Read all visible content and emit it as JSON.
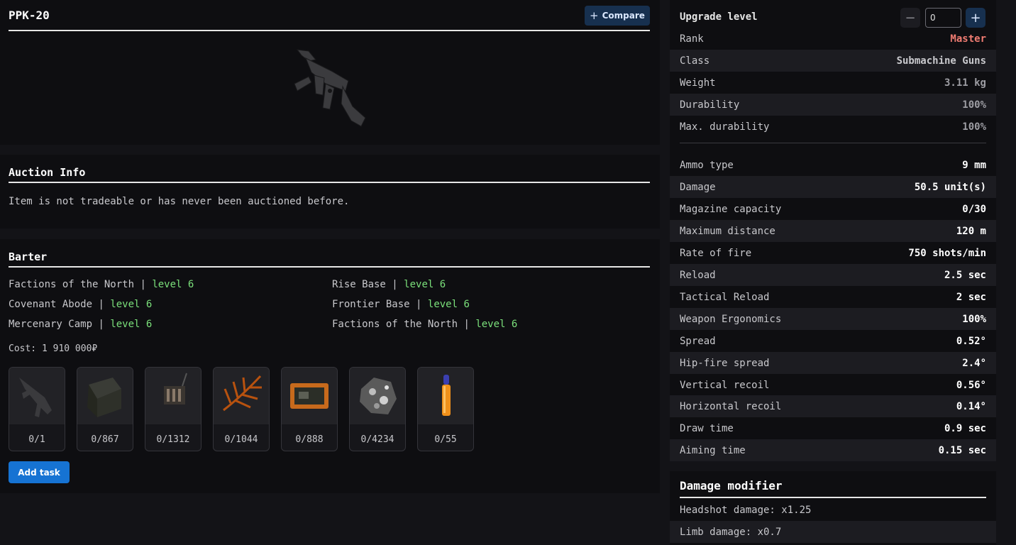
{
  "item": {
    "name": "PPK-20",
    "compare_label": "Compare"
  },
  "auction": {
    "title": "Auction Info",
    "message": "Item is not tradeable or has never been auctioned before."
  },
  "barter": {
    "title": "Barter",
    "sources": [
      {
        "name": "Factions of the North",
        "sep": "|",
        "level": "level 6"
      },
      {
        "name": "Rise Base",
        "sep": "|",
        "level": "level 6"
      },
      {
        "name": "Covenant Abode",
        "sep": "|",
        "level": "level 6"
      },
      {
        "name": "Frontier Base",
        "sep": "|",
        "level": "level 6"
      },
      {
        "name": "Mercenary Camp",
        "sep": "|",
        "level": "level 6"
      },
      {
        "name": "Factions of the North",
        "sep": "|",
        "level": "level 6"
      }
    ],
    "cost": "Cost: 1 910 000₽",
    "items": [
      {
        "icon": "smg-icon",
        "count": "0/1"
      },
      {
        "icon": "ammo-crate-icon",
        "count": "0/867"
      },
      {
        "icon": "device-icon",
        "count": "0/1312"
      },
      {
        "icon": "fern-icon",
        "count": "0/1044"
      },
      {
        "icon": "circuit-board-icon",
        "count": "0/888"
      },
      {
        "icon": "ore-icon",
        "count": "0/4234"
      },
      {
        "icon": "vial-icon",
        "count": "0/55"
      }
    ],
    "add_task_label": "Add task"
  },
  "stats": {
    "upgrade_label": "Upgrade level",
    "upgrade_value": "0",
    "minus": "−",
    "plus": "+",
    "rank": {
      "label": "Rank",
      "value": "Master"
    },
    "general": [
      {
        "label": "Class",
        "value": "Submachine Guns"
      },
      {
        "label": "Weight",
        "value": "3.11 kg"
      },
      {
        "label": "Durability",
        "value": "100%"
      },
      {
        "label": "Max. durability",
        "value": "100%"
      }
    ],
    "weapon": [
      {
        "label": "Ammo type",
        "value": "9 mm"
      },
      {
        "label": "Damage",
        "value": "50.5 unit(s)"
      },
      {
        "label": "Magazine capacity",
        "value": "0/30"
      },
      {
        "label": "Maximum distance",
        "value": "120 m"
      },
      {
        "label": "Rate of fire",
        "value": "750 shots/min"
      },
      {
        "label": "Reload",
        "value": "2.5 sec"
      },
      {
        "label": "Tactical Reload",
        "value": "2 sec"
      },
      {
        "label": "Weapon Ergonomics",
        "value": "100%"
      },
      {
        "label": "Spread",
        "value": "0.52°"
      },
      {
        "label": "Hip-fire spread",
        "value": "2.4°"
      },
      {
        "label": "Vertical recoil",
        "value": "0.56°"
      },
      {
        "label": "Horizontal recoil",
        "value": "0.14°"
      },
      {
        "label": "Draw time",
        "value": "0.9 sec"
      },
      {
        "label": "Aiming time",
        "value": "0.15 sec"
      }
    ]
  },
  "damage_modifier": {
    "title": "Damage modifier",
    "headshot": "Headshot damage: x1.25",
    "limb": "Limb damage: x0.7"
  },
  "colors": {
    "accent": "#1673d3",
    "level_green": "#7be07b",
    "rank_red": "#f07c72",
    "compare_bg": "#17304f"
  }
}
